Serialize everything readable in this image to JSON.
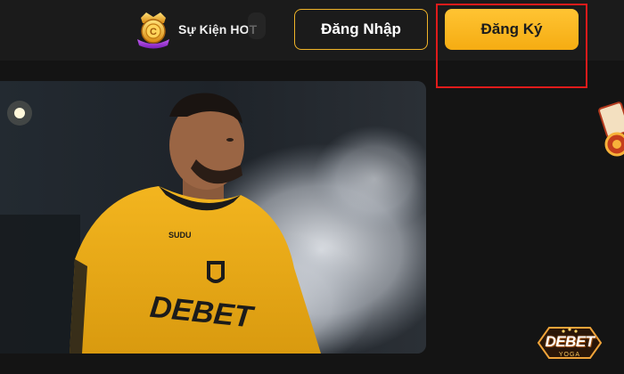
{
  "header": {
    "event_label": "Sự Kiện HOT",
    "login_label": "Đăng Nhập",
    "register_label": "Đăng Ký"
  },
  "hero": {
    "jersey_brand": "SUDU",
    "jersey_sponsor": "DEBET"
  },
  "brand": {
    "logo_text": "DEBET",
    "logo_sub": "YOGA"
  },
  "colors": {
    "accent": "#f5ac12",
    "highlight": "#e01b1b",
    "background": "#141414"
  },
  "icons": [
    "trophy-badge-icon",
    "casino-chips-icon",
    "debet-logo-icon"
  ]
}
